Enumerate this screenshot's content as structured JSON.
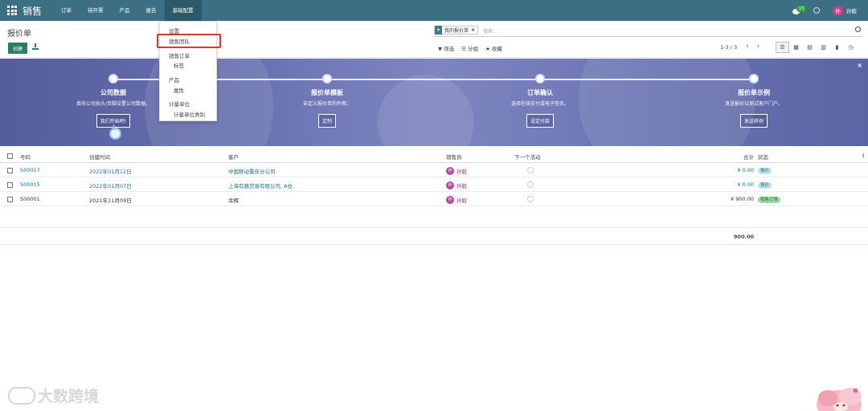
{
  "app": {
    "brand": "销售"
  },
  "nav": {
    "items": [
      "订单",
      "待开票",
      "产品",
      "报告",
      "基础配置"
    ],
    "active": "基础配置",
    "chat_count": "13",
    "user_initial": "孙",
    "user_name": "孙毅"
  },
  "control_panel": {
    "title": "报价单",
    "create_label": "创建",
    "search_facet": "我的报价单",
    "search_placeholder": "搜索...",
    "filter_label": "筛选",
    "group_label": "分组",
    "favorite_label": "收藏",
    "pager": "1-3 / 3"
  },
  "dropdown": {
    "items": [
      {
        "label": "设置",
        "type": "header"
      },
      {
        "label": "销售团队",
        "type": "sub",
        "highlighted": true
      },
      {
        "label": "销售订单",
        "type": "header"
      },
      {
        "label": "标签",
        "type": "sub"
      },
      {
        "label": "产品",
        "type": "header"
      },
      {
        "label": "属性",
        "type": "sub"
      },
      {
        "label": "计量单位",
        "type": "header"
      },
      {
        "label": "计量单位类别",
        "type": "sub"
      }
    ]
  },
  "banner": {
    "steps": [
      {
        "title": "公司数据",
        "desc": "填充公司抬头/页脚设置公司数据。",
        "button": "我们开始吧!"
      },
      {
        "title": "报价单模板",
        "desc": "自定义报价单的外观。",
        "button": "定制"
      },
      {
        "title": "订单确认",
        "desc": "选择在线支付或电子签名。",
        "button": "设定付款"
      },
      {
        "title": "报价单示例",
        "desc": "发送报价以测试客户门户。",
        "button": "发送样例"
      }
    ]
  },
  "table": {
    "headers": {
      "number": "号码",
      "created": "创建时间",
      "customer": "客户",
      "salesperson": "销售员",
      "activity": "下一个活动",
      "total": "合计",
      "status": "状态"
    },
    "rows": [
      {
        "number": "S00017",
        "created": "2022年01月12日",
        "customer": "中国移动重庆分公司",
        "salesperson": "孙毅",
        "total": "¥ 0.00",
        "status": "报价",
        "status_color": "#bfe4ea"
      },
      {
        "number": "S00015",
        "created": "2022年01月07日",
        "customer": "上海有路贸易有限公司, A仓",
        "salesperson": "孙毅",
        "total": "¥ 0.00",
        "status": "报价",
        "status_color": "#bfe4ea"
      },
      {
        "number": "S00001",
        "created": "2021年11月09日",
        "customer": "余辉",
        "salesperson": "孙毅",
        "total": "¥ 900.00",
        "status": "销售订单",
        "status_color": "#9fdcac"
      }
    ],
    "sum_total": "900.00"
  },
  "watermark": {
    "text": "大数跨境"
  }
}
